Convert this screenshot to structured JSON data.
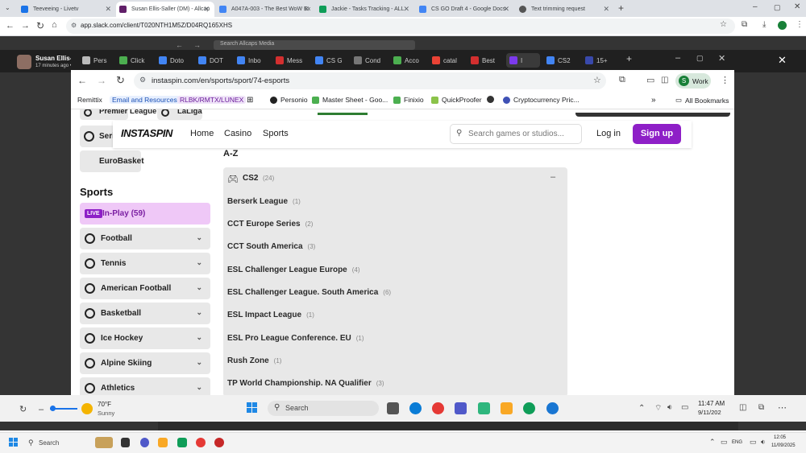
{
  "outer_browser": {
    "tabs": [
      {
        "title": "Teeveeing - Livetv",
        "color": "#1a73e8"
      },
      {
        "title": "Susan Ellis-Saller (DM) - Allcap",
        "color": "#611f69",
        "active": true
      },
      {
        "title": "A047A-003 - The Best WoW Ex",
        "color": "#4285f4"
      },
      {
        "title": "Jackie - Tasks Tracking - ALL",
        "color": "#0f9d58"
      },
      {
        "title": "CS GO Draft 4 - Google Docs",
        "color": "#4285f4"
      },
      {
        "title": "Text trimming request",
        "color": "#555555"
      }
    ],
    "url": "app.slack.com/client/T020NTH1M5Z/D04RQ165XHS"
  },
  "slack": {
    "search_placeholder": "Search Allcaps Media"
  },
  "viewer": {
    "user_name": "Susan Ellis-Saller",
    "meta": "17 minutes ago • Screenshot (144).png"
  },
  "inner_browser": {
    "tabs": [
      {
        "title": "Pers",
        "color": "#bbbbbb"
      },
      {
        "title": "Click",
        "color": "#4caf50"
      },
      {
        "title": "Doto",
        "color": "#4285f4"
      },
      {
        "title": "DOT",
        "color": "#4285f4"
      },
      {
        "title": "Inbo",
        "color": "#4285f4"
      },
      {
        "title": "Mess",
        "color": "#d32f2f"
      },
      {
        "title": "CS G",
        "color": "#4285f4"
      },
      {
        "title": "Cond",
        "color": "#777777"
      },
      {
        "title": "Acco",
        "color": "#4caf50"
      },
      {
        "title": "catal",
        "color": "#ea4335"
      },
      {
        "title": "Best",
        "color": "#d32f2f"
      },
      {
        "title": "I",
        "color": "#7c3aed",
        "active": true
      },
      {
        "title": "CS2",
        "color": "#4285f4"
      },
      {
        "title": "15+",
        "color": "#3949ab"
      }
    ],
    "url": "instaspin.com/en/sports/sport/74-esports",
    "profile_label": "Work",
    "profile_initial": "S",
    "bookmarks": [
      {
        "label": "Remittix"
      },
      {
        "label": "Email and Resources"
      },
      {
        "label": "RLBK/RMTX/LUNEX"
      },
      {
        "label": "Personio"
      },
      {
        "label": "Master Sheet - Goo..."
      },
      {
        "label": "Finixio"
      },
      {
        "label": "QuickProofer"
      },
      {
        "label": "Cryptocurrency Pric..."
      }
    ],
    "all_bookmarks": "All Bookmarks"
  },
  "site": {
    "logo": "INSTASPIN",
    "nav": [
      "Home",
      "Casino",
      "Sports"
    ],
    "search_placeholder": "Search games or studios...",
    "login": "Log in",
    "signup": "Sign up",
    "accent_color": "#8e1fc7"
  },
  "sidebar": {
    "top_items": [
      "Premier League",
      "LaLiga",
      "Seri",
      "EuroBasket"
    ],
    "section_title": "Sports",
    "live_badge": "LIVE",
    "live_label": "In-Play (59)",
    "items": [
      "Football",
      "Tennis",
      "American Football",
      "Basketball",
      "Ice Hockey",
      "Alpine Skiing",
      "Athletics"
    ]
  },
  "main": {
    "heading": "A-Z",
    "group_title": "CS2",
    "group_count": "(24)",
    "leagues": [
      {
        "name": "Berserk League",
        "count": "(1)"
      },
      {
        "name": "CCT Europe Series",
        "count": "(2)"
      },
      {
        "name": "CCT South America",
        "count": "(3)"
      },
      {
        "name": "ESL Challenger League Europe",
        "count": "(4)"
      },
      {
        "name": "ESL Challenger League. South America",
        "count": "(6)"
      },
      {
        "name": "ESL Impact League",
        "count": "(1)"
      },
      {
        "name": "ESL Pro League Conference. EU",
        "count": "(1)"
      },
      {
        "name": "Rush Zone",
        "count": "(1)"
      },
      {
        "name": "TP World Championship. NA Qualifier",
        "count": "(3)"
      }
    ]
  },
  "inner_taskbar": {
    "temp": "70°F",
    "weather": "Sunny",
    "search": "Search",
    "time": "11:47 AM",
    "date": "9/11/202"
  },
  "outer_taskbar": {
    "search": "Search",
    "lang": "ENG",
    "time": "12:05",
    "date": "11/09/2025"
  }
}
